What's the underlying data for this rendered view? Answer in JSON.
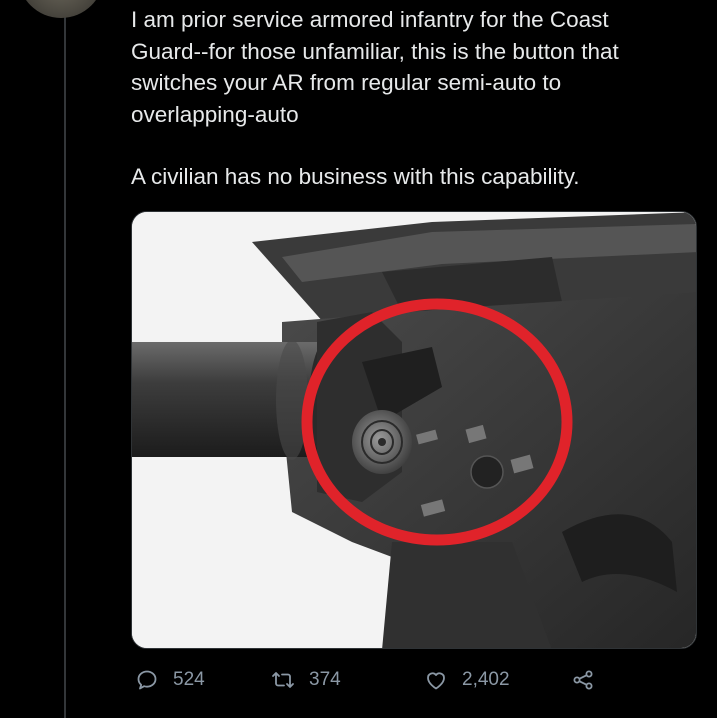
{
  "tweet": {
    "paragraph1": "I am prior service armored infantry for the Coast\nGuard--for those unfamiliar, this is the button that\nswitches your AR from regular semi-auto to\noverlapping-auto",
    "paragraph2": "A civilian has no business with this capability."
  },
  "actions": {
    "reply_count": "524",
    "retweet_count": "374",
    "like_count": "2,402"
  },
  "icons": {
    "reply": "speech-bubble-icon",
    "retweet": "retweet-icon",
    "like": "heart-icon",
    "share": "share-icon"
  },
  "colors": {
    "background": "#000000",
    "text": "#e7e9ea",
    "muted": "#8b98a5",
    "highlight_circle": "#e0232a"
  }
}
